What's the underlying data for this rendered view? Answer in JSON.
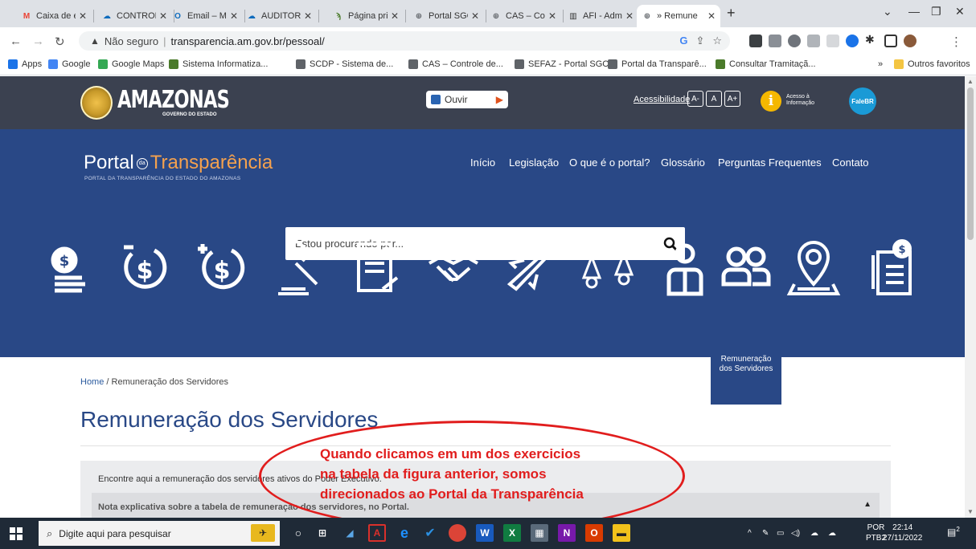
{
  "browser": {
    "tabs": [
      {
        "label": "Caixa de e",
        "icon": "gmail-icon",
        "color": "#ea4335",
        "glyph": "M"
      },
      {
        "label": "CONTROLE",
        "icon": "onedrive-icon",
        "color": "#0f6cbd",
        "glyph": "☁"
      },
      {
        "label": "Email – Ma",
        "icon": "outlook-icon",
        "color": "#0f6cbd",
        "glyph": "O"
      },
      {
        "label": "AUDITORIA",
        "icon": "onedrive-icon",
        "color": "#0f6cbd",
        "glyph": "☁"
      },
      {
        "label": "Página prin",
        "icon": "leaf-icon",
        "color": "#4a7a2a",
        "glyph": "ϡ"
      },
      {
        "label": "Portal SGC",
        "icon": "globe-icon",
        "color": "#5f6368",
        "glyph": "⊕"
      },
      {
        "label": "CAS – Con",
        "icon": "globe-icon",
        "color": "#5f6368",
        "glyph": "⊕"
      },
      {
        "label": "AFI - Adm",
        "icon": "afi-icon",
        "color": "#333333",
        "glyph": "▥"
      },
      {
        "label": "» Remune",
        "icon": "globe-icon",
        "color": "#5f6368",
        "glyph": "⊕",
        "active": true
      }
    ],
    "address": {
      "security": "Não seguro",
      "url": "transparencia.am.gov.br/pessoal/"
    },
    "bookmarks": [
      {
        "label": "Apps",
        "color": "#1a73e8"
      },
      {
        "label": "Google",
        "color": "#4285f4"
      },
      {
        "label": "Google Maps",
        "color": "#34a853"
      },
      {
        "label": "Sistema Informatiza...",
        "color": "#4a7a2a"
      },
      {
        "label": "SCDP - Sistema de...",
        "color": "#5f6368"
      },
      {
        "label": "CAS – Controle de...",
        "color": "#5f6368"
      },
      {
        "label": "SEFAZ - Portal SGC",
        "color": "#5f6368"
      },
      {
        "label": "Portal da Transparê...",
        "color": "#5f6368"
      },
      {
        "label": "Consultar Tramitaçã...",
        "color": "#4a7a2a"
      }
    ],
    "more_bookmarks": "»",
    "other_bookmarks": "Outros favoritos"
  },
  "site": {
    "gov": {
      "name": "AMAZONAS",
      "subtitle": "GOVERNO DO ESTADO",
      "ouvir_label": "Ouvir",
      "accessibility_label": "Acessibilidade",
      "font_buttons": [
        "A-",
        "A",
        "A+"
      ],
      "info_line1": "Acesso à",
      "info_line2": "Informação",
      "falebr_label": "FaleBR"
    },
    "portal": {
      "title_left": "Portal",
      "title_da": "da",
      "title_right": "Transparência",
      "subtitle": "PORTAL DA TRANSPARÊNCIA DO ESTADO DO AMAZONAS"
    },
    "nav": [
      "Início",
      "Legislação",
      "O que é o portal?",
      "Glossário",
      "Perguntas Frequentes",
      "Contato"
    ],
    "search": {
      "placeholder": "Estou procurando por..."
    },
    "categories": [
      {
        "icon": "coins-icon"
      },
      {
        "icon": "expenses-icon"
      },
      {
        "icon": "revenue-icon"
      },
      {
        "icon": "gavel-icon"
      },
      {
        "icon": "contract-icon"
      },
      {
        "icon": "handshake-icon"
      },
      {
        "icon": "airplane-icon"
      },
      {
        "icon": "scale-icon"
      },
      {
        "icon": "person-icon"
      },
      {
        "icon": "people-icon",
        "active": true,
        "label": "Remuneração dos Servidores"
      },
      {
        "icon": "location-icon"
      },
      {
        "icon": "document-list-icon"
      }
    ],
    "breadcrumb": {
      "home": "Home",
      "separator": "/",
      "current": "Remuneração dos Servidores"
    },
    "page_title": "Remuneração dos Servidores",
    "intro_text": "Encontre aqui a remuneração dos servidores ativos do Poder Executivo.",
    "note_text": "Nota explicativa sobre a tabela de remuneração dos servidores, no Portal."
  },
  "annotation": {
    "line1": "Quando clicamos em um dos exercicios",
    "line2": "na tabela da figura anterior, somos",
    "line3": "direcionados ao Portal da Transparência",
    "color": "#e11d1d"
  },
  "taskbar": {
    "search_placeholder": "Digite aqui para pesquisar",
    "lang_top": "POR",
    "lang_bottom": "PTB2",
    "time": "22:14",
    "date": "27/11/2022",
    "notifications": "2"
  }
}
